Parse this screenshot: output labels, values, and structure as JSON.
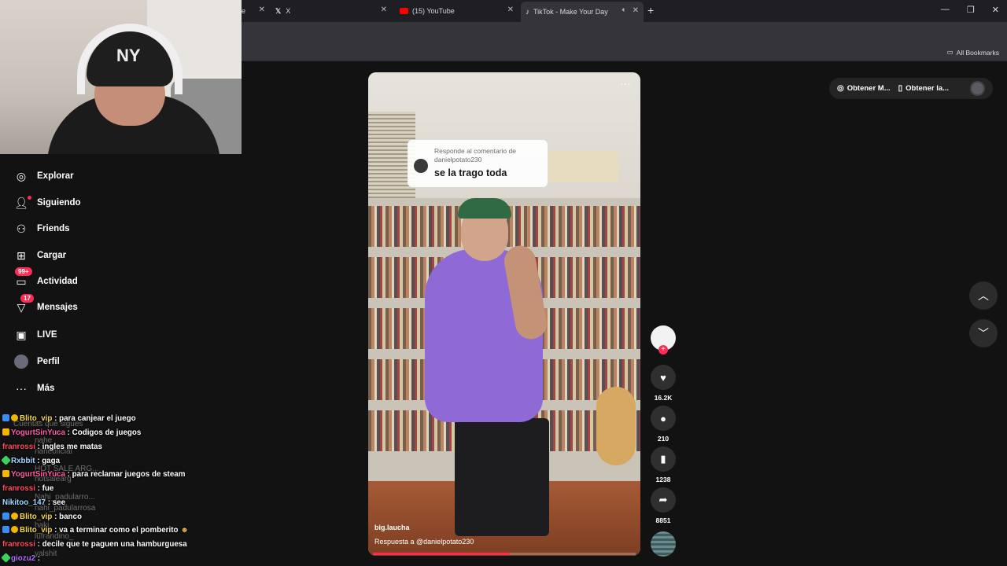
{
  "browser": {
    "tabs": [
      {
        "label": "e"
      },
      {
        "label": "X",
        "icon": "x-logo-icon"
      },
      {
        "label": "(15) YouTube",
        "icon": "youtube-icon"
      },
      {
        "label": "TikTok - Make Your Day",
        "icon": "tiktok-icon",
        "active": true
      }
    ],
    "new_tab": "+",
    "all_bookmarks": "All Bookmarks"
  },
  "sidebar": {
    "items": [
      {
        "label": "Explorar",
        "icon": "compass-icon"
      },
      {
        "label": "Siguiendo",
        "icon": "following-icon"
      },
      {
        "label": "Friends",
        "icon": "friends-icon"
      },
      {
        "label": "Cargar",
        "icon": "upload-icon"
      },
      {
        "label": "Actividad",
        "icon": "activity-icon",
        "badge": "99+"
      },
      {
        "label": "Mensajes",
        "icon": "messages-icon",
        "badge": "17"
      },
      {
        "label": "LIVE",
        "icon": "live-icon"
      },
      {
        "label": "Perfil",
        "icon": "profile-avatar-icon"
      },
      {
        "label": "Más",
        "icon": "more-icon"
      }
    ],
    "following_heading": "Cuentas que sigues",
    "following": [
      "nahe",
      "naheoficial",
      "HOT SALE ARG...",
      "hotsalearg",
      "Nahi_padularro...",
      "nahi_padularrosa",
      "haki",
      "lufrandino_",
      "yalshit"
    ]
  },
  "chat": [
    {
      "user": "Blito_vip",
      "message": "para canjear el juego",
      "color": "#f5d84a"
    },
    {
      "user": "YogurtSinYuca",
      "message": "Codigos de juegos",
      "color": "#ff5fa8"
    },
    {
      "user": "franrossi",
      "message": "ingles me matas",
      "color": "#ff4a5c"
    },
    {
      "user": "Rxbbit",
      "message": "gaga",
      "color": "#a4d8ff"
    },
    {
      "user": "YogurtSinYuca",
      "message": "para reclamar juegos de steam",
      "color": "#ff5fa8"
    },
    {
      "user": "franrossi",
      "message": "fue",
      "color": "#ff4a5c"
    },
    {
      "user": "Nikitoo_147",
      "message": "see",
      "color": "#a4d8ff"
    },
    {
      "user": "Blito_vip",
      "message": "banco",
      "color": "#f5d84a"
    },
    {
      "user": "Blito_vip",
      "message": "va a terminar como el pomberito",
      "color": "#f5d84a"
    },
    {
      "user": "franrossi",
      "message": "decile que te paguen una hamburguesa",
      "color": "#ff4a5c"
    },
    {
      "user": "giozu2",
      "message": "",
      "color": "#b86bff"
    }
  ],
  "video": {
    "reply_header": "Responde al comentario de danielpotato230",
    "reply_text": "se la trago toda",
    "author": "big.laucha",
    "caption": "Respuesta a @danielpotato230",
    "progress": 0.52
  },
  "actions": {
    "likes": "16.2K",
    "comments": "210",
    "saves": "1238",
    "shares": "8851"
  },
  "topright": {
    "get_coins": "Obtener M...",
    "get_app": "Obtener la..."
  },
  "colors": {
    "accent": "#fe2c55",
    "background": "#121212"
  }
}
